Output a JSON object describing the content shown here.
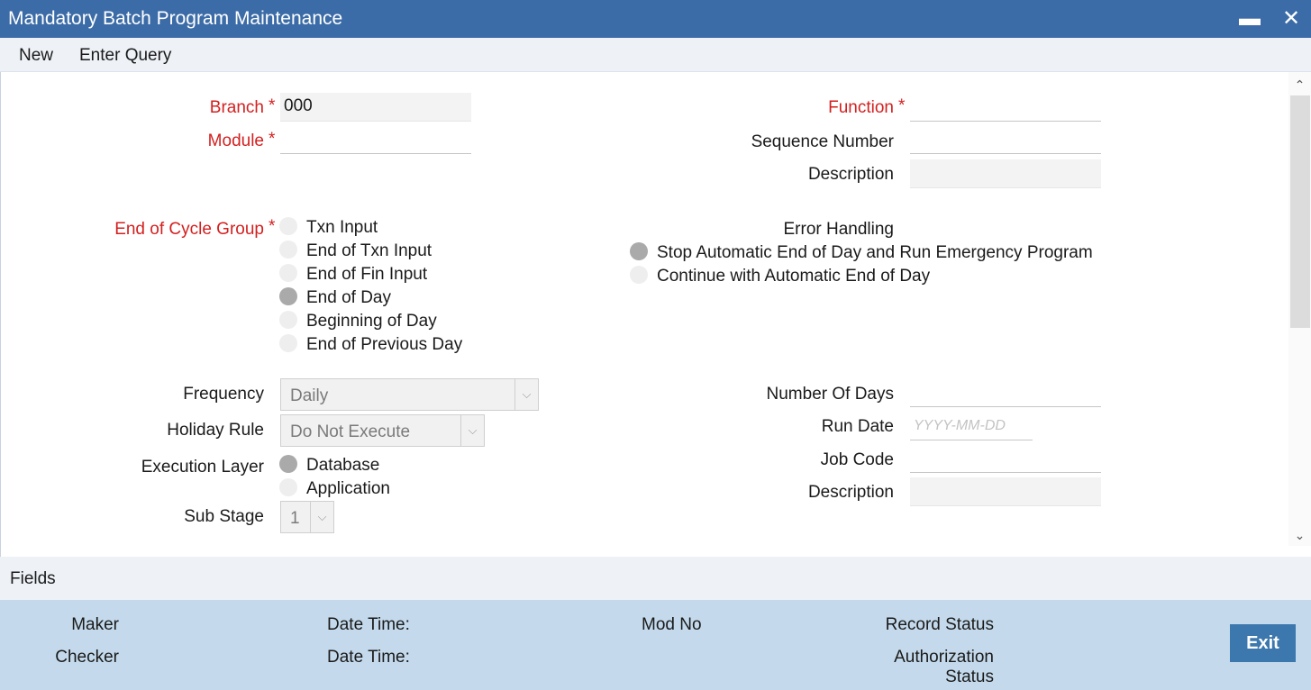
{
  "window": {
    "title": "Mandatory Batch Program Maintenance",
    "minimize_glyph": "▬",
    "close_glyph": "✕"
  },
  "menu": {
    "new": "New",
    "enter_query": "Enter Query"
  },
  "form": {
    "branch": {
      "label": "Branch",
      "value": "000"
    },
    "module": {
      "label": "Module",
      "value": ""
    },
    "function": {
      "label": "Function",
      "value": ""
    },
    "sequence_number": {
      "label": "Sequence Number",
      "value": ""
    },
    "description1": {
      "label": "Description",
      "value": ""
    },
    "end_of_cycle_group": {
      "label": "End of Cycle Group",
      "options": [
        "Txn Input",
        "End of Txn Input",
        "End of Fin Input",
        "End of Day",
        "Beginning of Day",
        "End of Previous Day"
      ],
      "selected": "End of Day"
    },
    "error_handling": {
      "label": "Error Handling",
      "options": [
        "Stop Automatic End of Day and Run Emergency Program",
        "Continue with Automatic End of Day"
      ],
      "selected": "Stop Automatic End of Day and Run Emergency Program"
    },
    "frequency": {
      "label": "Frequency",
      "value": "Daily"
    },
    "holiday_rule": {
      "label": "Holiday Rule",
      "value": "Do Not Execute"
    },
    "execution_layer": {
      "label": "Execution Layer",
      "options": [
        "Database",
        "Application"
      ],
      "selected": "Database"
    },
    "sub_stage": {
      "label": "Sub Stage",
      "value": "1"
    },
    "number_of_days": {
      "label": "Number Of Days",
      "value": ""
    },
    "run_date": {
      "label": "Run Date",
      "placeholder": "YYYY-MM-DD"
    },
    "job_code": {
      "label": "Job Code",
      "value": ""
    },
    "description2": {
      "label": "Description",
      "value": ""
    },
    "required_mark": "*"
  },
  "fields_bar": {
    "label": "Fields"
  },
  "footer": {
    "maker": "Maker",
    "checker": "Checker",
    "date_time_1": "Date Time:",
    "date_time_2": "Date Time:",
    "mod_no": "Mod No",
    "record_status": "Record Status",
    "authorization": "Authorization",
    "status": "Status",
    "exit": "Exit"
  },
  "colors": {
    "titlebar": "#3c6ca7",
    "required": "#d41f1f",
    "footer": "#c4daec",
    "exit_button": "#3c77ad"
  },
  "icons": {
    "minimize": "minimize-icon",
    "close": "close-icon",
    "dropdown": "chevron-down-icon",
    "scroll_up": "chevron-up-icon",
    "scroll_down": "chevron-down-icon"
  }
}
